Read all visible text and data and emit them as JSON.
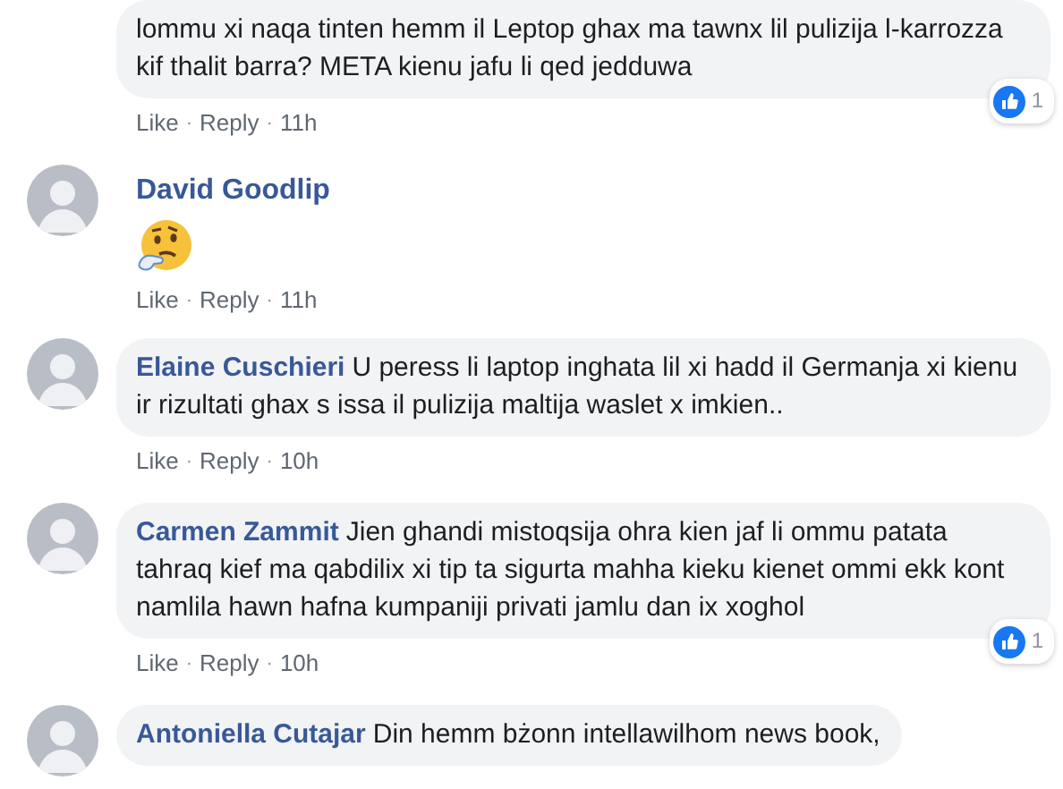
{
  "separator": "·",
  "comments": [
    {
      "kind": "text",
      "text": "lommu xi naqa tinten hemm il Leptop ghax ma tawnx lil pulizija l-karrozza kif thalit barra? META kienu jafu li qed jedduwa",
      "actions": [
        "Like",
        "Reply",
        "11h"
      ],
      "reactions": "1"
    },
    {
      "kind": "emoji",
      "author": "David Goodlip",
      "actions": [
        "Like",
        "Reply",
        "11h"
      ]
    },
    {
      "kind": "text",
      "author": "Elaine Cuschieri",
      "text": "U peress li laptop inghata lil xi hadd il Germanja xi kienu ir rizultati ghax s issa il pulizija maltija waslet x imkien..",
      "actions": [
        "Like",
        "Reply",
        "10h"
      ]
    },
    {
      "kind": "text",
      "author": "Carmen Zammit",
      "text": "Jien ghandi mistoqsija ohra kien jaf li ommu patata tahraq kief ma qabdilix xi tip ta sigurta mahha kieku kienet ommi ekk kont namlila hawn hafna kumpaniji privati jamlu dan ix xoghol",
      "actions": [
        "Like",
        "Reply",
        "10h"
      ],
      "reactions": "1"
    },
    {
      "kind": "text",
      "author": "Antoniella Cutajar",
      "text": "Din hemm bżonn intellawilhom news book,"
    }
  ]
}
